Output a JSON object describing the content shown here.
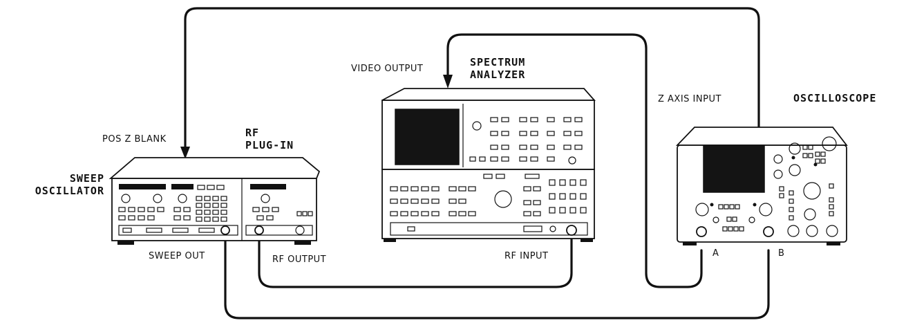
{
  "labels": {
    "pos_z_blank": "POS Z BLANK",
    "rf_plugin_1": "RF",
    "rf_plugin_2": "PLUG-IN",
    "sweep_osc_1": "SWEEP",
    "sweep_osc_2": "OSCILLATOR",
    "sweep_out": "SWEEP OUT",
    "rf_output": "RF OUTPUT",
    "video_output": "VIDEO OUTPUT",
    "spectrum_1": "SPECTRUM",
    "spectrum_2": "ANALYZER",
    "rf_input": "RF INPUT",
    "z_axis_input": "Z AXIS INPUT",
    "oscilloscope": "OSCILLOSCOPE",
    "channel_a": "A",
    "channel_b": "B"
  }
}
